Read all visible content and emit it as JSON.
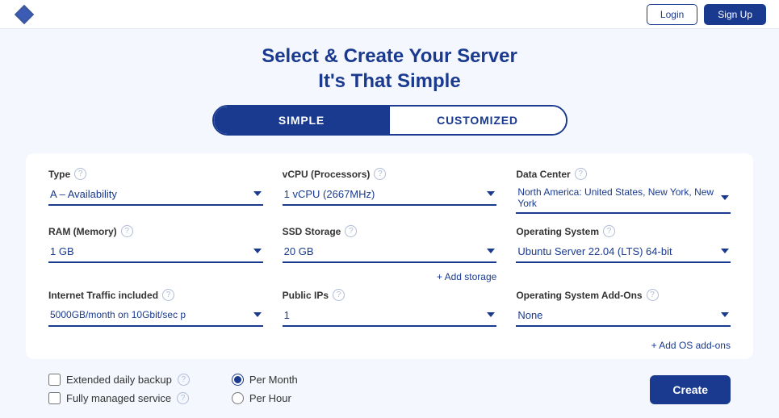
{
  "header": {
    "logo_alt": "Logo",
    "btn_login": "Login",
    "btn_signup": "Sign Up"
  },
  "page": {
    "title_line1": "Select & Create Your Server",
    "title_line2": "It's That Simple"
  },
  "tabs": {
    "simple_label": "SIMPLE",
    "customized_label": "CUSTOMIZED",
    "active": "simple"
  },
  "form": {
    "type": {
      "label": "Type",
      "value": "A – Availability"
    },
    "vcpu": {
      "label": "vCPU (Processors)",
      "value": "1 vCPU (2667MHz)"
    },
    "datacenter": {
      "label": "Data Center",
      "value": "North America: United States, New York, New York"
    },
    "ram": {
      "label": "RAM (Memory)",
      "value": "1 GB"
    },
    "ssd": {
      "label": "SSD Storage",
      "value": "20 GB"
    },
    "os": {
      "label": "Operating System",
      "value": "Ubuntu Server 22.04 (LTS) 64-bit"
    },
    "traffic": {
      "label": "Internet Traffic included",
      "value": "5000GB/month on 10Gbit/sec p"
    },
    "public_ips": {
      "label": "Public IPs",
      "value": "1"
    },
    "os_addons": {
      "label": "Operating System Add-Ons",
      "value": "None"
    },
    "add_storage_link": "+ Add storage",
    "add_os_link": "+ Add OS add-ons"
  },
  "checkboxes": [
    {
      "label": "Extended daily backup",
      "checked": false
    },
    {
      "label": "Fully managed service",
      "checked": false
    }
  ],
  "billing": [
    {
      "label": "Per Month",
      "selected": true
    },
    {
      "label": "Per Hour",
      "selected": false
    }
  ],
  "create_btn": "Create"
}
